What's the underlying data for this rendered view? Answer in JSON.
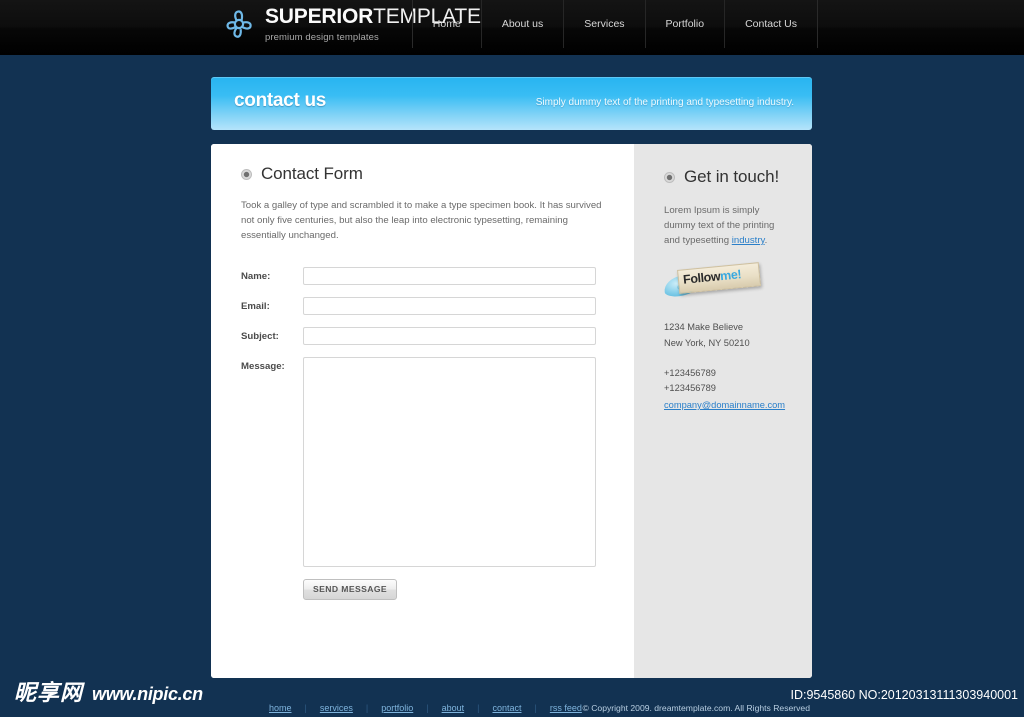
{
  "header": {
    "logo": {
      "icon": "flower-logo-icon",
      "title_bold": "SUPERIOR",
      "title_thin": "TEMPLATE",
      "tagline": "premium design templates"
    },
    "nav": [
      {
        "label": "Home"
      },
      {
        "label": "About us"
      },
      {
        "label": "Services"
      },
      {
        "label": "Portfolio"
      },
      {
        "label": "Contact Us"
      }
    ]
  },
  "banner": {
    "title": "contact us",
    "subtitle": "Simply dummy text of the printing and typesetting industry."
  },
  "main": {
    "heading": "Contact Form",
    "intro": "Took a galley of type and scrambled it to make a type specimen book. It has survived not only five centuries, but also the leap into electronic typesetting, remaining essentially unchanged.",
    "fields": [
      {
        "label": "Name:",
        "value": "",
        "placeholder": "",
        "type": "text",
        "name": "name-field"
      },
      {
        "label": "Email:",
        "value": "",
        "placeholder": "",
        "type": "text",
        "name": "email-field"
      },
      {
        "label": "Subject:",
        "value": "",
        "placeholder": "",
        "type": "text",
        "name": "subject-field"
      }
    ],
    "message_label": "Message:",
    "message_value": "",
    "message_placeholder": "",
    "submit_label": "SEND MESSAGE"
  },
  "sidebar": {
    "heading": "Get in touch!",
    "intro_before": "Lorem Ipsum is simply dummy text of the printing and typesetting ",
    "intro_link": "industry",
    "intro_after": ".",
    "follow": {
      "text_dark": "Follow",
      "text_blue": "me!",
      "icon": "twitter-bird-icon"
    },
    "address_line1": "1234 Make Believe",
    "address_line2": "New York, NY 50210",
    "phone1": "+123456789",
    "phone2": "+123456789",
    "email": "company@domainname.com"
  },
  "footer": {
    "links": [
      {
        "label": "home"
      },
      {
        "label": "services"
      },
      {
        "label": "portfolio"
      },
      {
        "label": "about"
      },
      {
        "label": "contact"
      },
      {
        "label": "rss feed"
      }
    ],
    "copyright": "© Copyright 2009. dreamtemplate.com. All Rights Reserved"
  },
  "watermark": {
    "cn": "昵享网",
    "url": "www.nipic.cn",
    "id_badge": "ID:9545860 NO:20120313111303940001"
  },
  "colors": {
    "page_bg": "#123252",
    "header_bg": "#0b0b0b",
    "banner_from": "#28b4f0",
    "banner_to": "#b5e4fb",
    "sidebar_bg": "#e6e6e6",
    "link": "#2a7fc9"
  }
}
